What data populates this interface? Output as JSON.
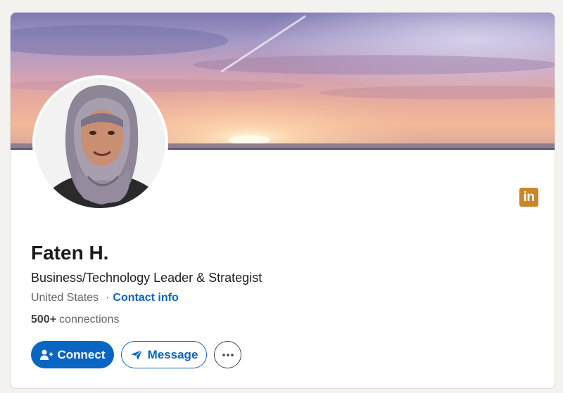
{
  "profile": {
    "name": "Faten H.",
    "headline": "Business/Technology Leader & Strategist",
    "location": "United States",
    "separator": "·",
    "contact_link": "Contact info",
    "connections_count": "500+",
    "connections_label": "connections"
  },
  "badge": {
    "text": "in",
    "icon": "linkedin-icon",
    "color": "#c9862a"
  },
  "actions": {
    "connect_label": "Connect",
    "connect_icon": "add-person-icon",
    "message_label": "Message",
    "message_icon": "paper-plane-icon",
    "more_icon": "ellipsis-icon"
  },
  "colors": {
    "primary": "#0a66c2",
    "page_background": "#f4f2ee"
  }
}
